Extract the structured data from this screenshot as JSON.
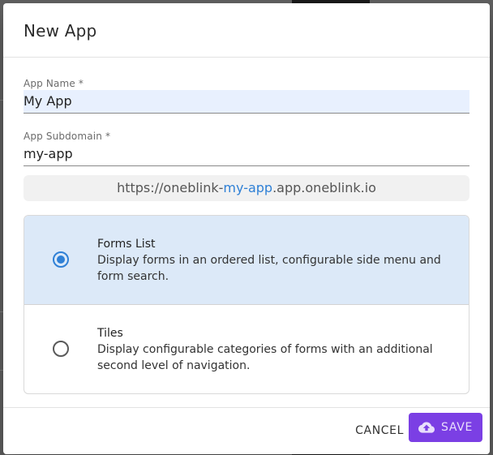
{
  "dialog": {
    "title": "New App",
    "fields": {
      "app_name": {
        "label": "App Name *",
        "value": "My App"
      },
      "subdomain": {
        "label": "App Subdomain *",
        "value": "my-app"
      }
    },
    "url_preview": {
      "prefix": "https://oneblink-",
      "highlight": "my-app",
      "suffix": ".app.oneblink.io"
    },
    "options": [
      {
        "title": "Forms List",
        "description": "Display forms in an ordered list, configurable side menu and form search.",
        "selected": true
      },
      {
        "title": "Tiles",
        "description": "Display configurable categories of forms with an additional second level of navigation.",
        "selected": false
      }
    ],
    "actions": {
      "cancel_label": "CANCEL",
      "save_label": "SAVE",
      "save_icon": "cloud-upload-icon"
    }
  },
  "colors": {
    "primary": "#7b3fe4",
    "accent_blue": "#2f80d6",
    "selected_bg": "#dce9f8"
  }
}
